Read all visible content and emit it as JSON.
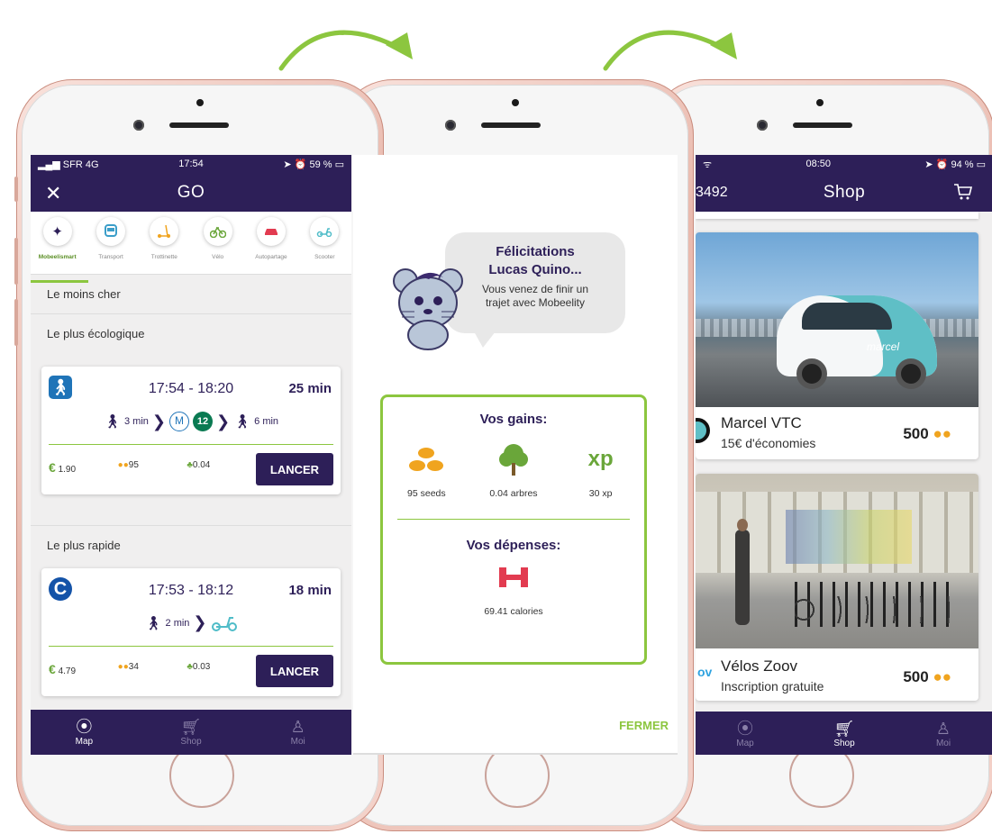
{
  "colors": {
    "purple": "#2d1f58",
    "green": "#8cc63f",
    "inactive": "#8a80a8"
  },
  "screen1": {
    "status": {
      "carrier": "SFR  4G",
      "time": "17:54",
      "battery": "59 %"
    },
    "nav_title": "GO",
    "modes": [
      {
        "label": "Mobeelismart",
        "icon": "mobeelismart-icon",
        "active": true
      },
      {
        "label": "Transport",
        "icon": "bus-icon",
        "active": false
      },
      {
        "label": "Trottinette",
        "icon": "scooter-kick-icon",
        "active": false
      },
      {
        "label": "Vélo",
        "icon": "bike-icon",
        "active": false
      },
      {
        "label": "Autopartage",
        "icon": "car-icon",
        "active": false
      },
      {
        "label": "Scooter",
        "icon": "moped-icon",
        "active": false
      }
    ],
    "sections": {
      "cheapest": "Le moins cher",
      "ecological": "Le plus écologique",
      "fastest": "Le plus rapide"
    },
    "routes": [
      {
        "time": "17:54 - 18:20",
        "duration": "25 min",
        "walk1": "3 min",
        "metro": "M",
        "line": "12",
        "walk2": "6 min",
        "price": "1.90",
        "seeds": "95",
        "trees": "0.04",
        "button": "LANCER"
      },
      {
        "time": "17:53 - 18:12",
        "duration": "18 min",
        "walk1": "2 min",
        "price": "4.79",
        "seeds": "34",
        "trees": "0.03",
        "button": "LANCER"
      }
    ],
    "currency": "€",
    "tabs": [
      {
        "label": "Map"
      },
      {
        "label": "Shop"
      },
      {
        "label": "Moi"
      }
    ]
  },
  "screen2": {
    "bubble_title_1": "Félicitations",
    "bubble_title_2": "Lucas Quino...",
    "bubble_text_1": "Vous venez de finir un",
    "bubble_text_2": "trajet avec Mobeelity",
    "gains_title": "Vos gains:",
    "gains": [
      {
        "label": "95 seeds"
      },
      {
        "label": "0.04 arbres"
      },
      {
        "label": "30 xp",
        "icon_text": "xp"
      }
    ],
    "spend_title": "Vos dépenses:",
    "calories": "69.41 calories",
    "close": "FERMER"
  },
  "screen3": {
    "status": {
      "time": "08:50",
      "battery": "94 %"
    },
    "nav_left": "3492",
    "nav_title": "Shop",
    "offers": [
      {
        "name": "Marcel VTC",
        "desc": "15€ d'économies",
        "price": "500"
      },
      {
        "name": "Vélos Zoov",
        "desc": "Inscription gratuite",
        "price": "500"
      }
    ],
    "car_brand": "marcel",
    "tabs": [
      {
        "label": "Map"
      },
      {
        "label": "Shop"
      },
      {
        "label": "Moi"
      }
    ]
  }
}
